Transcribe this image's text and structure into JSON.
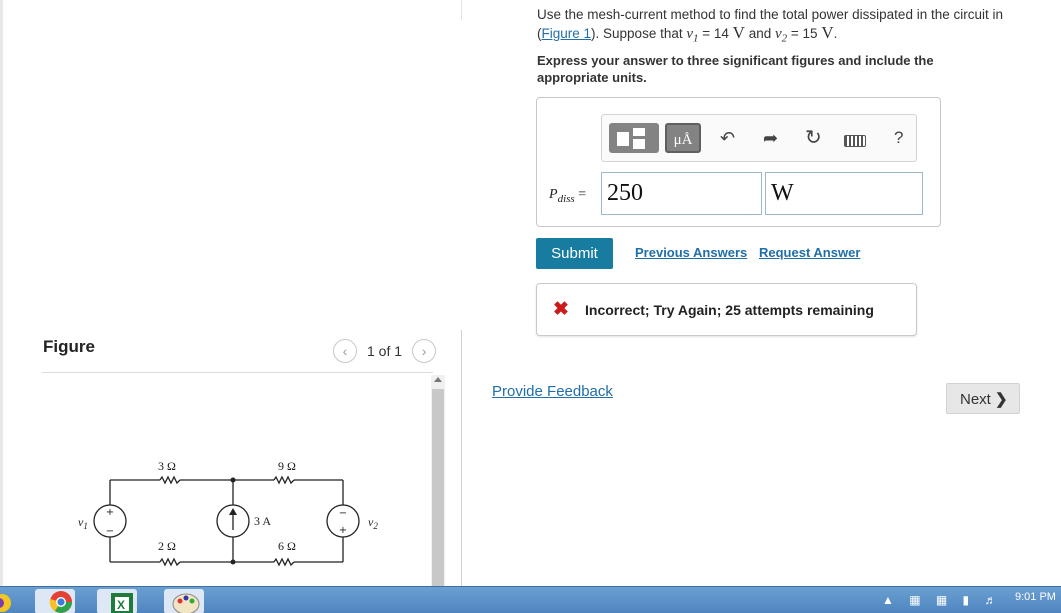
{
  "figure_panel": {
    "heading": "Figure",
    "pager_text": "1 of 1",
    "prev_icon": "chevron-left-icon",
    "next_icon": "chevron-right-icon",
    "circuit": {
      "labels": {
        "r1": "3 Ω",
        "r2": "9 Ω",
        "r3": "2 Ω",
        "r4": "6 Ω",
        "source_current": "3 A",
        "v1": "v",
        "v1_sub": "1",
        "v2": "v",
        "v2_sub": "2"
      }
    }
  },
  "question": {
    "text_before_link": "Use the mesh-current method to find the total power dissipated in the circuit in (",
    "link_text": "Figure 1",
    "text_after_link": "). Suppose that ",
    "v1_symbol": "v",
    "v1_sub": "1",
    "eq1": " = 14 ",
    "unit1": "V",
    "and": " and ",
    "v2_symbol": "v",
    "v2_sub": "2",
    "eq2": " = 15 ",
    "unit2": "V",
    "period": ".",
    "instruction": "Express your answer to three significant figures and include the appropriate units."
  },
  "answer": {
    "toolbar_icons": [
      "templates-icon",
      "units-icon",
      "undo-icon",
      "redo-icon",
      "reset-icon",
      "keyboard-icon",
      "help-icon"
    ],
    "units_button": "μÅ",
    "help": "?",
    "var_main": "P",
    "var_sub": "diss",
    "equals": "=",
    "value": "250",
    "unit": "W"
  },
  "actions": {
    "submit": "Submit",
    "previous_answers": "Previous Answers",
    "request_answer": "Request Answer"
  },
  "feedback": {
    "icon": "x-icon",
    "message": "Incorrect; Try Again; 25 attempts remaining"
  },
  "footer": {
    "provide_feedback": "Provide Feedback",
    "next": "Next"
  },
  "taskbar": {
    "apps": [
      "chrome-icon",
      "excel-icon",
      "paint-icon"
    ],
    "clock": "9:01 PM"
  }
}
